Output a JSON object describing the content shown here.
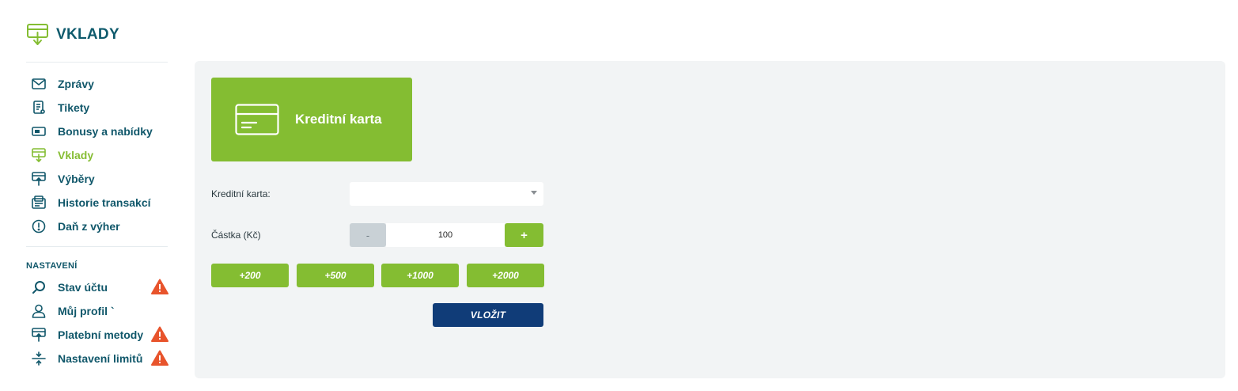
{
  "header": {
    "title": "VKLADY",
    "icon": "deposit-icon"
  },
  "sidebar": {
    "items": [
      {
        "label": "Zprávy",
        "icon": "envelope-icon"
      },
      {
        "label": "Tikety",
        "icon": "ticket-icon"
      },
      {
        "label": "Bonusy a nabídky",
        "icon": "bonus-icon"
      },
      {
        "label": "Vklady",
        "icon": "deposit-icon",
        "active": true
      },
      {
        "label": "Výběry",
        "icon": "withdrawal-icon"
      },
      {
        "label": "Historie transakcí",
        "icon": "history-icon"
      },
      {
        "label": "Daň z výher",
        "icon": "info-circle-icon"
      }
    ],
    "settings_title": "NASTAVENÍ",
    "settings_items": [
      {
        "label": "Stav účtu",
        "icon": "search-icon",
        "warning": true
      },
      {
        "label": "Můj profil `",
        "icon": "user-icon",
        "warning": false
      },
      {
        "label": "Platební metody",
        "icon": "payment-methods-icon",
        "warning": true
      },
      {
        "label": "Nastavení limitů",
        "icon": "limits-icon",
        "warning": true
      }
    ]
  },
  "main": {
    "method_card": {
      "label": "Kreditní karta",
      "icon": "credit-card-icon"
    },
    "card_select_label": "Kreditní karta:",
    "card_select_value": "",
    "amount_label": "Částka (Kč)",
    "amount_value": "100",
    "minus_label": "-",
    "plus_label": "+",
    "quick_amounts": [
      "+200",
      "+500",
      "+1000",
      "+2000"
    ],
    "submit_label": "VLOŽIT"
  },
  "colors": {
    "accent_green": "#84bd32",
    "brand_teal": "#0e5a6c",
    "submit_navy": "#103c78",
    "warning_red": "#e8542c",
    "panel_bg": "#f2f4f5"
  }
}
